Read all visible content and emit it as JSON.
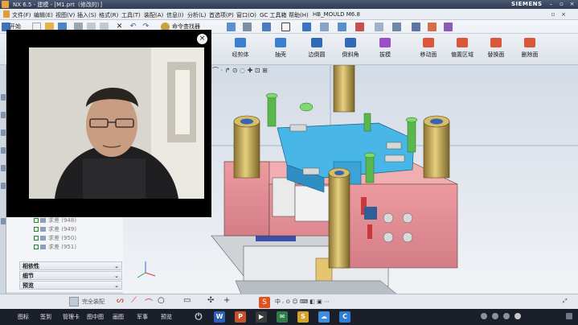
{
  "window": {
    "title": "NX 6.5 - 建模 - [M1.prt（修改的）]",
    "brand": "SIEMENS",
    "controls": [
      "minimize",
      "maximize",
      "close"
    ]
  },
  "menu": {
    "items": [
      "文件(F)",
      "编辑(E)",
      "视图(V)",
      "插入(S)",
      "格式(R)",
      "工具(T)",
      "装配(A)",
      "信息(I)",
      "分析(L)",
      "首选项(P)",
      "窗口(O)",
      "GC 工具箱",
      "帮助(H)",
      "HB_MOULD M6.8"
    ]
  },
  "toolbar": {
    "start_label": "开始",
    "command_finder": "命令查找器",
    "ribbon": [
      {
        "label": "经剪体",
        "color": "#3b7fd0"
      },
      {
        "label": "抽壳",
        "color": "#3b7fd0"
      },
      {
        "label": "边倒圆",
        "color": "#2f69b8"
      },
      {
        "label": "倒斜角",
        "color": "#2f69b8"
      },
      {
        "label": "拔模",
        "color": "#9b4ec8"
      },
      {
        "label": "移动面",
        "color": "#d8573a"
      },
      {
        "label": "偏置区域",
        "color": "#d8573a"
      },
      {
        "label": "替换面",
        "color": "#d8573a"
      },
      {
        "label": "删除面",
        "color": "#d8573a"
      }
    ]
  },
  "navigator": {
    "features": [
      {
        "label": "求差 (948)"
      },
      {
        "label": "求差 (949)"
      },
      {
        "label": "求差 (950)"
      },
      {
        "label": "求差 (951)"
      }
    ],
    "panels": [
      "相依性",
      "细节",
      "预览"
    ]
  },
  "webcam": {
    "close_icon": "close-icon"
  },
  "statusbar": {
    "selection_filter": "完全装配"
  },
  "taskbar": {
    "items": [
      "图标",
      "签到",
      "管理卡",
      "图中图",
      "画图",
      "军事",
      "预览"
    ],
    "apps": [
      {
        "label": "W",
        "color": "#2b5fb8"
      },
      {
        "label": "P",
        "color": "#c8502a"
      },
      {
        "label": "▶",
        "color": "#3b3b3b"
      },
      {
        "label": "✉",
        "color": "#2d7d46"
      },
      {
        "label": "S",
        "color": "#d8a22a"
      },
      {
        "label": "☁",
        "color": "#3c8ee0"
      },
      {
        "label": "C",
        "color": "#2f7ed6"
      }
    ]
  }
}
